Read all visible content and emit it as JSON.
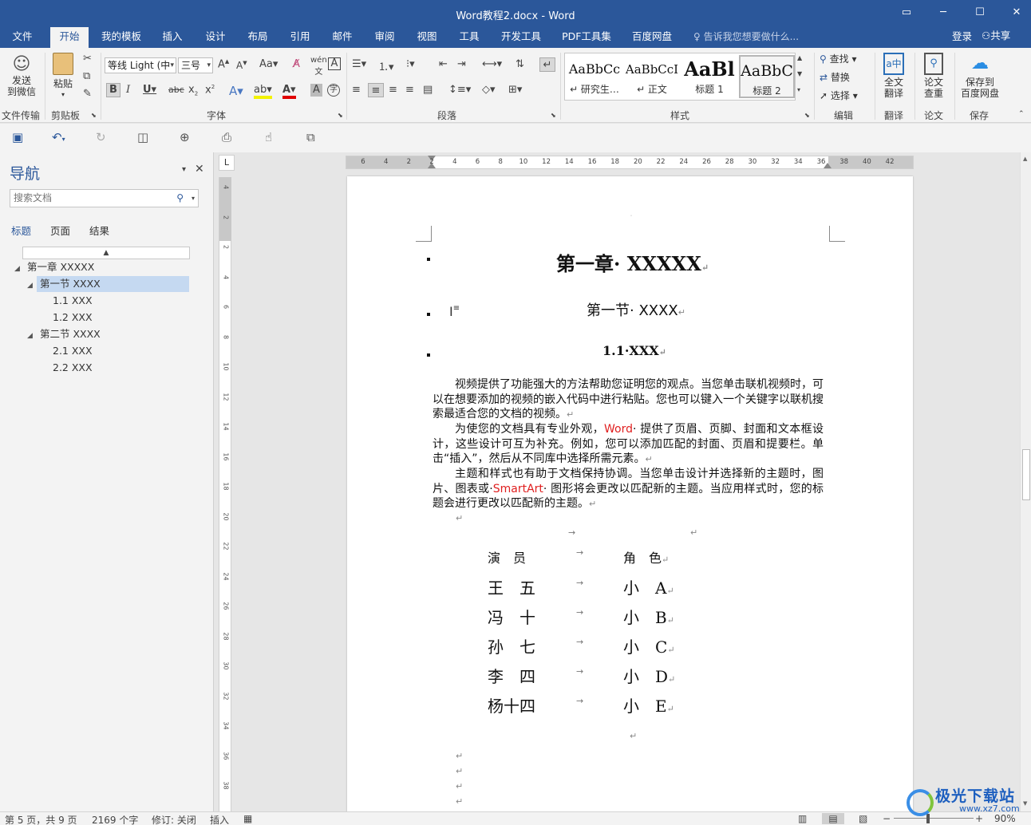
{
  "window": {
    "title": "Word教程2.docx - Word",
    "btn_restore": "▭",
    "btn_min": "─",
    "btn_max": "☐",
    "btn_close": "✕"
  },
  "tabs": [
    "文件",
    "开始",
    "我的模板",
    "插入",
    "设计",
    "布局",
    "引用",
    "邮件",
    "审阅",
    "视图",
    "工具",
    "开发工具",
    "PDF工具集",
    "百度网盘"
  ],
  "active_tab": "开始",
  "tell_me": "告诉我您想要做什么...",
  "login": "登录",
  "share": "共享",
  "ribbon": {
    "send_wechat": [
      "发送",
      "到微信"
    ],
    "group_file_transfer": "文件传输",
    "paste": "粘贴",
    "group_clipboard": "剪贴板",
    "font_name": "等线 Light (中",
    "font_size": "三号",
    "group_font": "字体",
    "group_paragraph": "段落",
    "styles": [
      {
        "sample": "AaBbCc",
        "name": "↵ 研究生…"
      },
      {
        "sample": "AaBbCcI",
        "name": "↵ 正文"
      },
      {
        "sample": "AaBl",
        "name": "标题 1"
      },
      {
        "sample": "AaBbC",
        "name": "标题 2"
      }
    ],
    "group_styles": "样式",
    "find": "查找",
    "replace": "替换",
    "select": "选择",
    "group_edit": "编辑",
    "full_translate": [
      "全文",
      "翻译"
    ],
    "group_translate": "翻译",
    "paper_check": [
      "论文",
      "查重"
    ],
    "group_paper": "论文",
    "save_baidu": [
      "保存到",
      "百度网盘"
    ],
    "group_save": "保存"
  },
  "nav": {
    "title": "导航",
    "search_placeholder": "搜索文档",
    "tabs": [
      "标题",
      "页面",
      "结果"
    ],
    "tree": [
      {
        "label": "第一章 XXXXX",
        "level": 0,
        "expanded": true
      },
      {
        "label": "第一节 XXXX",
        "level": 1,
        "expanded": true,
        "selected": true
      },
      {
        "label": "1.1 XXX",
        "level": 2
      },
      {
        "label": "1.2 XXX",
        "level": 2
      },
      {
        "label": "第二节 XXXX",
        "level": 1,
        "expanded": true
      },
      {
        "label": "2.1 XXX",
        "level": 2
      },
      {
        "label": "2.2 XXX",
        "level": 2
      }
    ]
  },
  "ruler_h": [
    "6",
    "4",
    "2",
    "2",
    "4",
    "6",
    "8",
    "10",
    "12",
    "14",
    "16",
    "18",
    "20",
    "22",
    "24",
    "26",
    "28",
    "30",
    "32",
    "34",
    "36",
    "38",
    "40",
    "42"
  ],
  "ruler_v": [
    "4",
    "2",
    "2",
    "4",
    "6",
    "8",
    "10",
    "12",
    "14",
    "16",
    "18",
    "20",
    "22",
    "24",
    "26",
    "28",
    "30",
    "32",
    "34",
    "36",
    "38"
  ],
  "document": {
    "heading1": "第一章· XXXXX",
    "heading2": "第一节· XXXX",
    "heading3": "1.1·XXX",
    "para1": "视频提供了功能强大的方法帮助您证明您的观点。当您单击联机视频时，可以在想要添加的视频的嵌入代码中进行粘贴。您也可以键入一个关键字以联机搜索最适合您的文档的视频。",
    "para2_a": "为使您的文档具有专业外观，",
    "para2_word": "Word",
    "para2_b": "· 提供了页眉、页脚、封面和文本框设计，这些设计可互为补充。例如，您可以添加匹配的封面、页眉和提要栏。单击“插入”，然后从不同库中选择所需元素。",
    "para3_a": "主题和样式也有助于文档保持协调。当您单击设计并选择新的主题时，图片、图表或·",
    "para3_smartart": "SmartArt",
    "para3_b": "· 图形将会更改以匹配新的主题。当应用样式时，您的标题会进行更改以匹配新的主题。",
    "table_header": [
      "演　员",
      "角　色"
    ],
    "table_rows": [
      [
        "王　五",
        "小　A"
      ],
      [
        "冯　十",
        "小　B"
      ],
      [
        "孙　七",
        "小　C"
      ],
      [
        "李　四",
        "小　D"
      ],
      [
        "杨十四",
        "小　E"
      ]
    ]
  },
  "status": {
    "page": "第 5 页，共 9 页",
    "words": "2169 个字",
    "track": "修订: 关闭",
    "insert": "插入",
    "zoom": "90%"
  },
  "watermark": {
    "text": "极光下载站",
    "url": "www.xz7.com"
  },
  "colors": {
    "accent": "#2b579a",
    "red_text": "#e02020",
    "nav_selected": "#c5d9f1"
  }
}
